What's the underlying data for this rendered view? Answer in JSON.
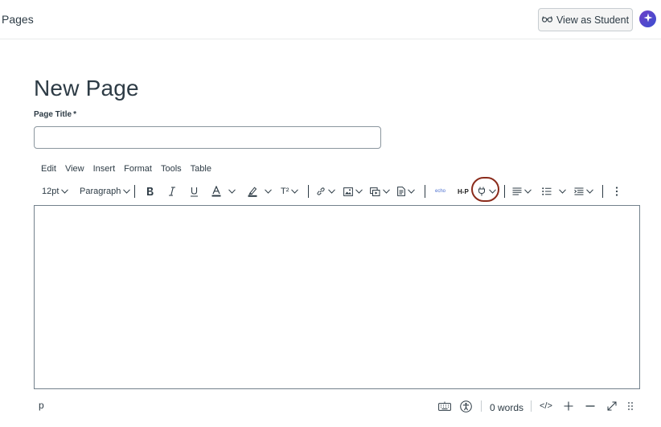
{
  "header": {
    "section": "Pages",
    "view_as_student": "View as Student"
  },
  "page": {
    "heading": "New Page",
    "title_label": "Page Title",
    "required_mark": "*",
    "title_value": ""
  },
  "menubar": [
    "Edit",
    "View",
    "Insert",
    "Format",
    "Tools",
    "Table"
  ],
  "toolbar": {
    "font_size": "12pt",
    "block_format": "Paragraph",
    "superscript_label": "T²",
    "echo_label": "echo",
    "h5p_label": "H-P"
  },
  "statusbar": {
    "path": "p",
    "word_count": "0 words",
    "html_toggle": "</>"
  },
  "colors": {
    "highlight_ring": "#8b2c1c",
    "ai_button": "#5b3fc9",
    "text": "#2d3b45"
  }
}
